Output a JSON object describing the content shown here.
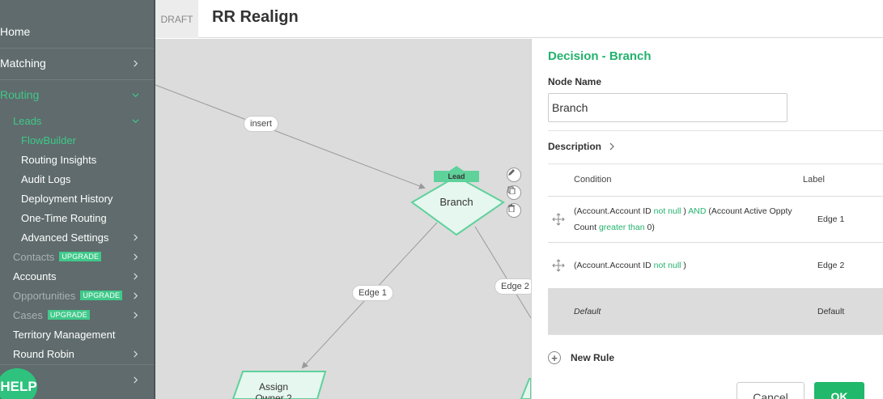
{
  "sidebar": {
    "home": "Home",
    "matching": "Matching",
    "routing": "Routing",
    "leads": "Leads",
    "flowbuilder": "FlowBuilder",
    "routing_insights": "Routing Insights",
    "audit_logs": "Audit Logs",
    "deployment_history": "Deployment History",
    "one_time_routing": "One-Time Routing",
    "advanced_settings": "Advanced Settings",
    "contacts": "Contacts",
    "accounts": "Accounts",
    "opportunities": "Opportunities",
    "cases": "Cases",
    "upgrade_badge": "UPGRADE",
    "territory_management": "Territory Management",
    "round_robin": "Round Robin",
    "help": "HELP"
  },
  "header": {
    "status": "DRAFT",
    "title": "RR Realign"
  },
  "canvas": {
    "edge_insert": "insert",
    "edge_1": "Edge 1",
    "edge_2": "Edge 2",
    "node_tag": "Lead",
    "node_branch": "Branch",
    "node_assign_line1": "Assign",
    "node_assign_line2": "Owner 2",
    "icons": [
      "pencil-icon",
      "copy-icon",
      "trash-icon"
    ]
  },
  "panel": {
    "title": "Decision - Branch",
    "node_name_label": "Node Name",
    "node_name_value": "Branch",
    "description_label": "Description",
    "col_condition": "Condition",
    "col_label": "Label",
    "rules": [
      {
        "p1": "(Account.Account ID",
        "op1": "not null",
        "p2": ")",
        "op2": "AND",
        "p3": "(Account Active Oppty Count",
        "op3": "greater than",
        "p4": "0)",
        "label": "Edge 1"
      },
      {
        "p1": "(Account.Account ID",
        "op1": "not null",
        "p2": ")",
        "label": "Edge 2"
      }
    ],
    "default_condition": "Default",
    "default_label": "Default",
    "new_rule": "New Rule",
    "cancel": "Cancel",
    "ok": "OK"
  },
  "colors": {
    "accent": "#23b26d",
    "sidebar_bg": "#5f6b6c",
    "canvas_bg": "#dcdcdc",
    "node_fill": "#e6f7ef",
    "node_stroke": "#5fd19b"
  }
}
